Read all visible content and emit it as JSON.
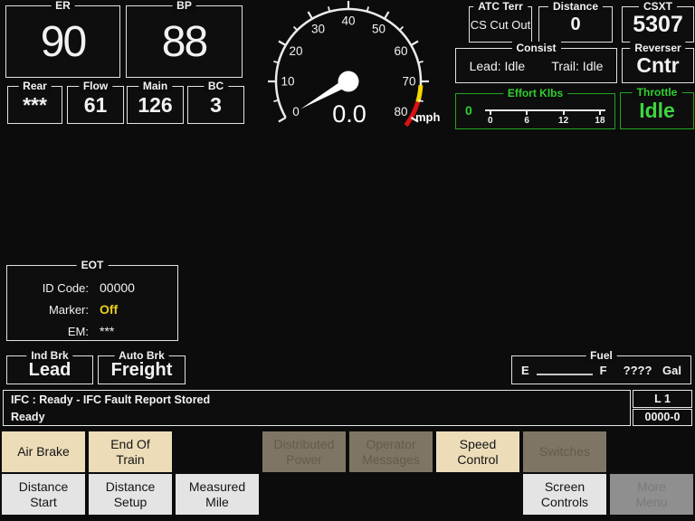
{
  "colors": {
    "background": "#0c0c0c",
    "box_border": "#e2e2e2",
    "text": "#f2f2f2",
    "green_border": "#22a522",
    "green_text": "#3fd43f",
    "marker_yellow": "#e8cf1d",
    "zone_yellow": "#f5d800",
    "zone_red": "#dd1111",
    "button_tan": "#ecdcb8",
    "button_disabled_bg": "#7f7565",
    "button_disabled_text": "#635c4d",
    "button_gray": "#e4e4e4",
    "button_gray_disabled_bg": "#8f8f8f",
    "button_gray_disabled_text": "#7a7a7a"
  },
  "gauges": {
    "er": {
      "label": "ER",
      "value": "90"
    },
    "bp": {
      "label": "BP",
      "value": "88"
    },
    "rear": {
      "label": "Rear",
      "value": "***"
    },
    "flow": {
      "label": "Flow",
      "value": "61"
    },
    "main": {
      "label": "Main",
      "value": "126"
    },
    "bc": {
      "label": "BC",
      "value": "3"
    }
  },
  "speedometer": {
    "type": "gauge",
    "unit": "mph",
    "display_value": "0.0",
    "value": 0,
    "min": 0,
    "max": 80,
    "major_tick_step": 10,
    "minor_tick_step": 5,
    "start_angle_deg": 210,
    "deg_per_unit": 3,
    "tick_labels": [
      "0",
      "10",
      "20",
      "30",
      "40",
      "50",
      "60",
      "70",
      "80"
    ],
    "yellow_zone": [
      71,
      75.5
    ],
    "red_zone": [
      75.5,
      82.5
    ]
  },
  "top_right": {
    "atc_terr": {
      "label": "ATC Terr",
      "value": "CS Cut Out"
    },
    "distance": {
      "label": "Distance",
      "value": "0"
    },
    "unit_id": {
      "label": "CSXT",
      "value": "5307"
    },
    "consist": {
      "label": "Consist",
      "lead": "Lead: Idle",
      "trail": "Trail: Idle"
    },
    "reverser": {
      "label": "Reverser",
      "value": "Cntr"
    },
    "effort": {
      "label": "Effort Klbs",
      "value": "0",
      "scale": [
        "0",
        "6",
        "12",
        "18"
      ]
    },
    "throttle": {
      "label": "Throttle",
      "value": "Idle"
    }
  },
  "eot": {
    "label": "EOT",
    "id_code": {
      "label": "ID Code:",
      "value": "00000"
    },
    "marker": {
      "label": "Marker:",
      "value": "Off"
    },
    "em": {
      "label": "EM:",
      "value": "***"
    }
  },
  "brakes": {
    "ind_brk": {
      "label": "Ind Brk",
      "value": "Lead"
    },
    "auto_brk": {
      "label": "Auto Brk",
      "value": "Freight"
    }
  },
  "fuel": {
    "label": "Fuel",
    "empty_mark": "E",
    "full_mark": "F",
    "quantity": "????",
    "unit": "Gal"
  },
  "status": {
    "line1": "IFC : Ready - IFC Fault Report Stored",
    "line2": "Ready",
    "screen_id": "L 1",
    "code": "0000-0"
  },
  "menu": {
    "air_brake": "Air Brake",
    "end_of_train": "End Of\nTrain",
    "distributed_power": "Distributed\nPower",
    "operator_messages": "Operator\nMessages",
    "speed_control": "Speed\nControl",
    "switches": "Switches",
    "distance_start": "Distance\nStart",
    "distance_setup": "Distance\nSetup",
    "measured_mile": "Measured\nMile",
    "screen_controls": "Screen\nControls",
    "more_menu": "More\nMenu"
  }
}
